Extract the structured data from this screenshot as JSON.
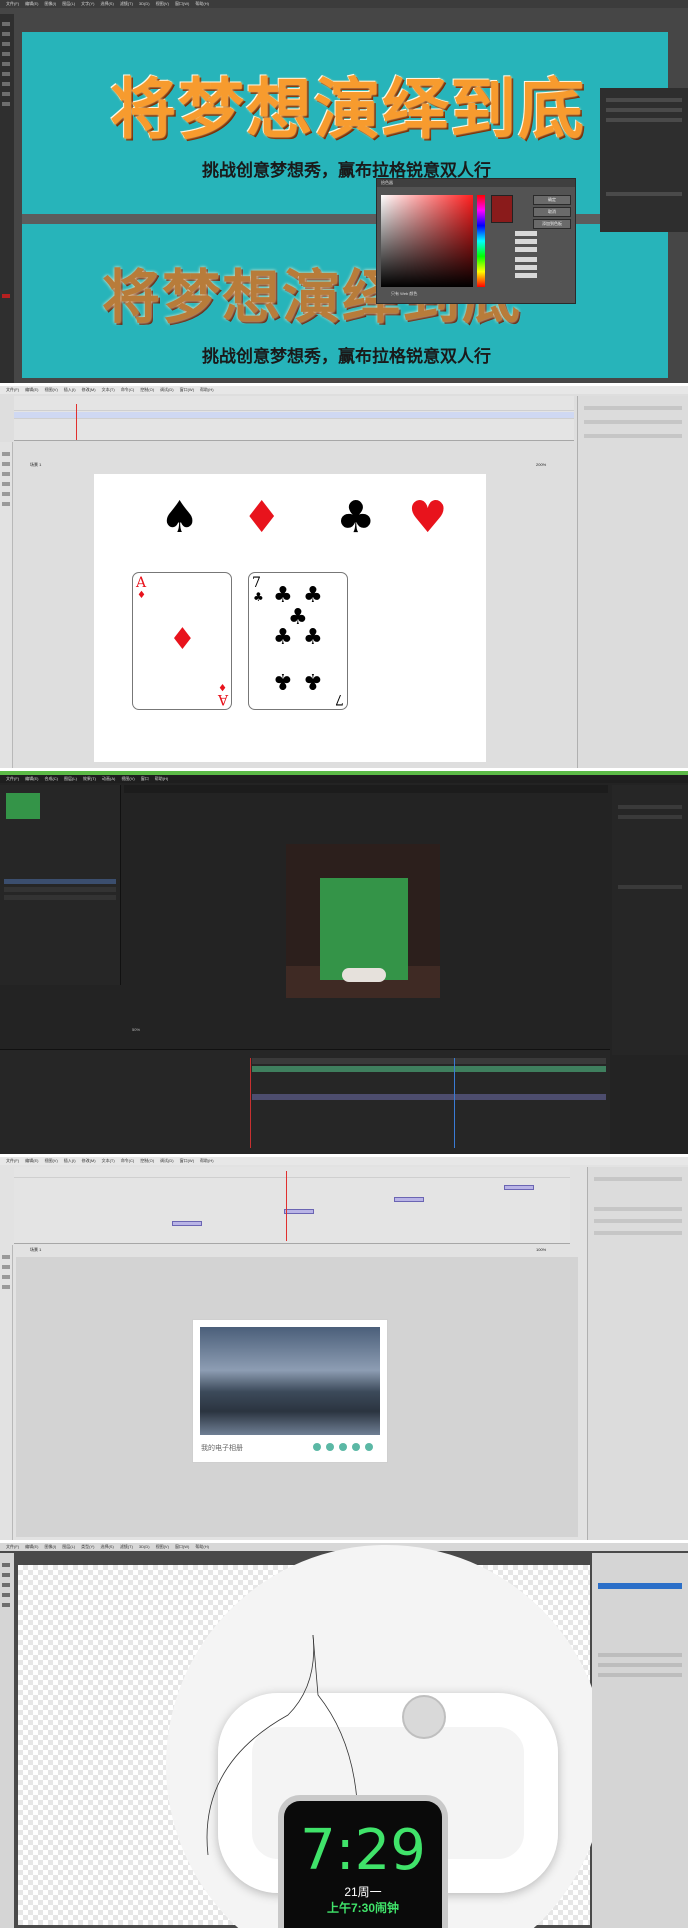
{
  "panel1": {
    "menu": [
      "文件(F)",
      "编辑(E)",
      "图像(I)",
      "图层(L)",
      "文字(Y)",
      "选择(S)",
      "滤镜(T)",
      "3D(D)",
      "视图(V)",
      "窗口(W)",
      "帮助(H)"
    ],
    "banner_title": "将梦想演绎到底",
    "banner_subtitle": "挑战创意梦想秀，赢布拉格锐意双人行",
    "color_picker": {
      "title": "拾色器",
      "buttons": [
        "确定",
        "取消",
        "添加到色板"
      ],
      "web_only": "只有 Web 颜色"
    }
  },
  "panel2": {
    "menu": [
      "文件(F)",
      "编辑(E)",
      "视图(V)",
      "插入(I)",
      "修改(M)",
      "文本(T)",
      "命令(C)",
      "控制(O)",
      "调试(D)",
      "窗口(W)",
      "帮助(H)"
    ],
    "scene_label": "场景 1",
    "zoom": "200%",
    "suits": [
      {
        "glyph": "♠",
        "color": "#000000"
      },
      {
        "glyph": "♦",
        "color": "#e8131c"
      },
      {
        "glyph": "♣",
        "color": "#000000"
      },
      {
        "glyph": "♥",
        "color": "#e8131c"
      }
    ],
    "card_a": {
      "rank": "A",
      "suit": "♦",
      "color": "#e8131c"
    },
    "card_7": {
      "rank": "7",
      "suit": "♣",
      "color": "#000000"
    }
  },
  "panel3": {
    "menu": [
      "文件(F)",
      "编辑(E)",
      "合成(C)",
      "图层(L)",
      "效果(T)",
      "动画(A)",
      "视图(V)",
      "窗口",
      "帮助(H)"
    ],
    "zoom": "50%",
    "accent": "#5cba47"
  },
  "panel4": {
    "menu": [
      "文件(F)",
      "编辑(E)",
      "视图(V)",
      "插入(I)",
      "修改(M)",
      "文本(T)",
      "命令(C)",
      "控制(O)",
      "调试(D)",
      "窗口(W)",
      "帮助(H)"
    ],
    "scene_label": "场景 1",
    "zoom": "100%",
    "album_title": "我的电子相册"
  },
  "panel5": {
    "menu": [
      "文件(F)",
      "编辑(E)",
      "图像(I)",
      "图层(L)",
      "类型(Y)",
      "选择(S)",
      "滤镜(T)",
      "3D(D)",
      "视图(V)",
      "窗口(W)",
      "帮助(H)"
    ],
    "watch_time": "7:29",
    "watch_date": "21周一",
    "watch_alarm": "上午7:30闹钟"
  }
}
